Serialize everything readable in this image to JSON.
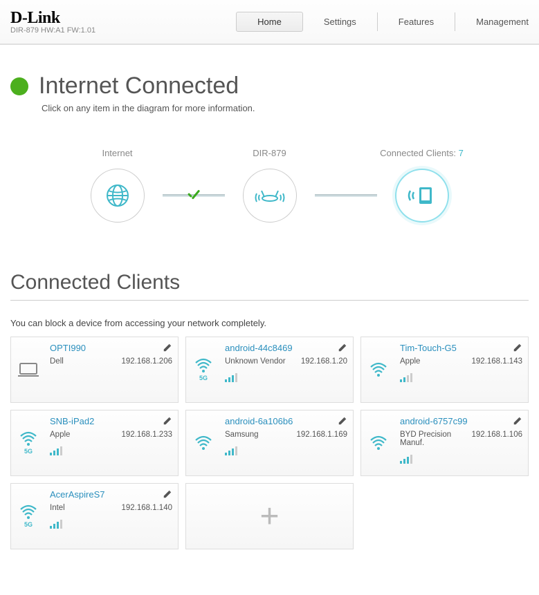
{
  "brand": {
    "logo": "D-Link",
    "model": "DIR-879 HW:A1 FW:1.01"
  },
  "nav": {
    "items": [
      "Home",
      "Settings",
      "Features",
      "Management"
    ],
    "active": "Home"
  },
  "status": {
    "title": "Internet Connected",
    "subtitle": "Click on any item in the diagram for more information."
  },
  "diagram": {
    "internet_label": "Internet",
    "router_label": "DIR-879",
    "clients_label": "Connected Clients:",
    "clients_count": "7"
  },
  "clients_section": {
    "title": "Connected Clients",
    "subtitle": "You can block a device from accessing your network completely."
  },
  "clients": [
    {
      "name": "OPTI990",
      "vendor": "Dell",
      "ip": "192.168.1.206",
      "conn": "wired",
      "band": "",
      "signal": 0,
      "show_signal": false
    },
    {
      "name": "android-44c8469",
      "vendor": "Unknown Vendor",
      "ip": "192.168.1.20",
      "conn": "wifi",
      "band": "5G",
      "signal": 3,
      "show_signal": true
    },
    {
      "name": "Tim-Touch-G5",
      "vendor": "Apple",
      "ip": "192.168.1.143",
      "conn": "wifi",
      "band": "",
      "signal": 2,
      "show_signal": true
    },
    {
      "name": "SNB-iPad2",
      "vendor": "Apple",
      "ip": "192.168.1.233",
      "conn": "wifi",
      "band": "5G",
      "signal": 3,
      "show_signal": true
    },
    {
      "name": "android-6a106b6",
      "vendor": "Samsung",
      "ip": "192.168.1.169",
      "conn": "wifi",
      "band": "",
      "signal": 3,
      "show_signal": true
    },
    {
      "name": "android-6757c99",
      "vendor": "BYD Precision Manuf.",
      "ip": "192.168.1.106",
      "conn": "wifi",
      "band": "",
      "signal": 3,
      "show_signal": true
    },
    {
      "name": "AcerAspireS7",
      "vendor": "Intel",
      "ip": "192.168.1.140",
      "conn": "wifi",
      "band": "5G",
      "signal": 3,
      "show_signal": true
    }
  ]
}
